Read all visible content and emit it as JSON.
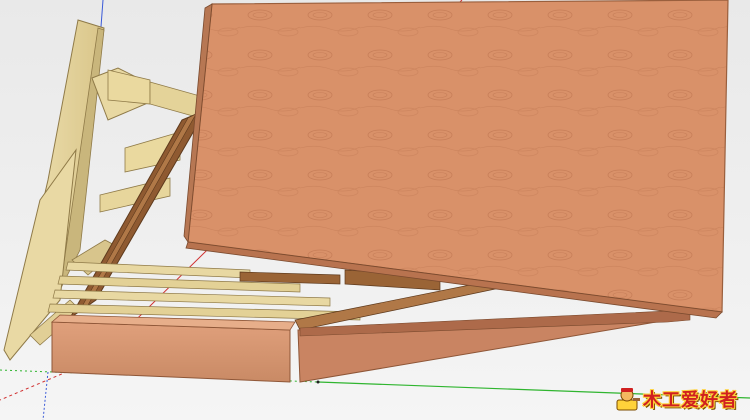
{
  "viewport": {
    "background": "#ececec",
    "axes": {
      "red": "#d03030",
      "green": "#2fb52f",
      "blue": "#3a5ad8"
    }
  },
  "model": {
    "panel_color": "#d9906a",
    "panel_edge": "#b56a45",
    "pine_color": "#e7d6a0",
    "pine_edge": "#a88f55",
    "dark_wood": "#9a6436"
  },
  "watermark": {
    "text": "木工爱好者",
    "icon": "woodworker-mascot-icon",
    "colors": {
      "fill": "#d02020",
      "outline": "#ffd23a"
    }
  }
}
